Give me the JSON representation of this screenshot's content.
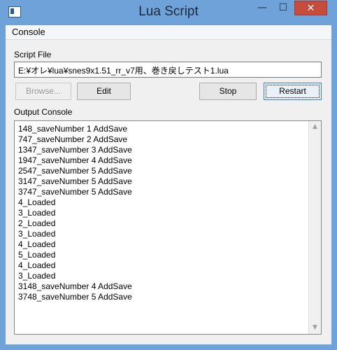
{
  "window": {
    "title": "Lua Script",
    "minimize_glyph": "—",
    "maximize_glyph": "☐",
    "close_glyph": "✕"
  },
  "menu": {
    "items": [
      "Console"
    ]
  },
  "script_file": {
    "label": "Script File",
    "path": "E:¥オレ¥lua¥snes9x1.51_rr_v7用、巻き戻しテスト1.lua"
  },
  "buttons": {
    "browse": "Browse...",
    "edit": "Edit",
    "stop": "Stop",
    "restart": "Restart"
  },
  "output": {
    "label": "Output Console",
    "lines": [
      "148_saveNumber 1 AddSave",
      "747_saveNumber 2 AddSave",
      "1347_saveNumber 3 AddSave",
      "1947_saveNumber 4 AddSave",
      "2547_saveNumber 5 AddSave",
      "3147_saveNumber 5 AddSave",
      "3747_saveNumber 5 AddSave",
      "4_Loaded",
      "3_Loaded",
      "2_Loaded",
      "3_Loaded",
      "4_Loaded",
      "5_Loaded",
      "4_Loaded",
      "3_Loaded",
      "3148_saveNumber 4 AddSave",
      "3748_saveNumber 5 AddSave"
    ]
  },
  "colors": {
    "frame": "#6fa2d8",
    "close_button": "#c74c3e",
    "client_bg": "#f0f0f0"
  }
}
